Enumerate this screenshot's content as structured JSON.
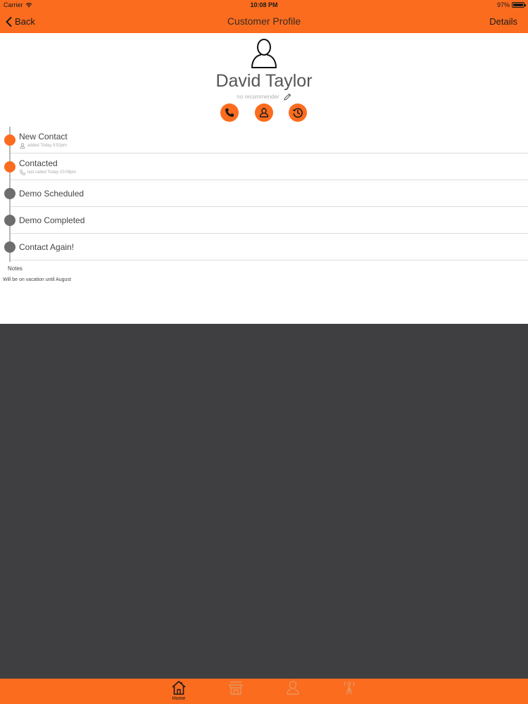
{
  "status_bar": {
    "carrier": "Carrier",
    "time": "10:08 PM",
    "battery": "97%",
    "battery_level": 0.97
  },
  "nav": {
    "back_label": "Back",
    "title": "Customer Profile",
    "details_label": "Details"
  },
  "customer": {
    "name": "David Taylor",
    "recommender": "no recommender",
    "actions": [
      "phone-icon",
      "person-icon",
      "history-icon"
    ]
  },
  "timeline": {
    "stages": [
      {
        "label": "New Contact",
        "sub": "added Today 9:53pm",
        "sub_icon": "person-icon",
        "done": true
      },
      {
        "label": "Contacted",
        "sub": "last called Today 10:06pm",
        "sub_icon": "phone-icon",
        "done": true
      },
      {
        "label": "Demo Scheduled",
        "sub": "",
        "done": false
      },
      {
        "label": "Demo Completed",
        "sub": "",
        "done": false
      },
      {
        "label": "Contact Again!",
        "sub": "",
        "done": false
      }
    ]
  },
  "notes": {
    "label": "Notes",
    "text": "Will be on vacation until August"
  },
  "tab_bar": {
    "tabs": [
      {
        "label": "Home",
        "icon": "home-icon",
        "active": true
      },
      {
        "label": "",
        "icon": "store-icon",
        "active": false
      },
      {
        "label": "",
        "icon": "person-icon",
        "active": false
      },
      {
        "label": "",
        "icon": "tower-icon",
        "active": false
      }
    ]
  },
  "colors": {
    "accent": "#fb6c1f",
    "background": "#3f3e40"
  }
}
